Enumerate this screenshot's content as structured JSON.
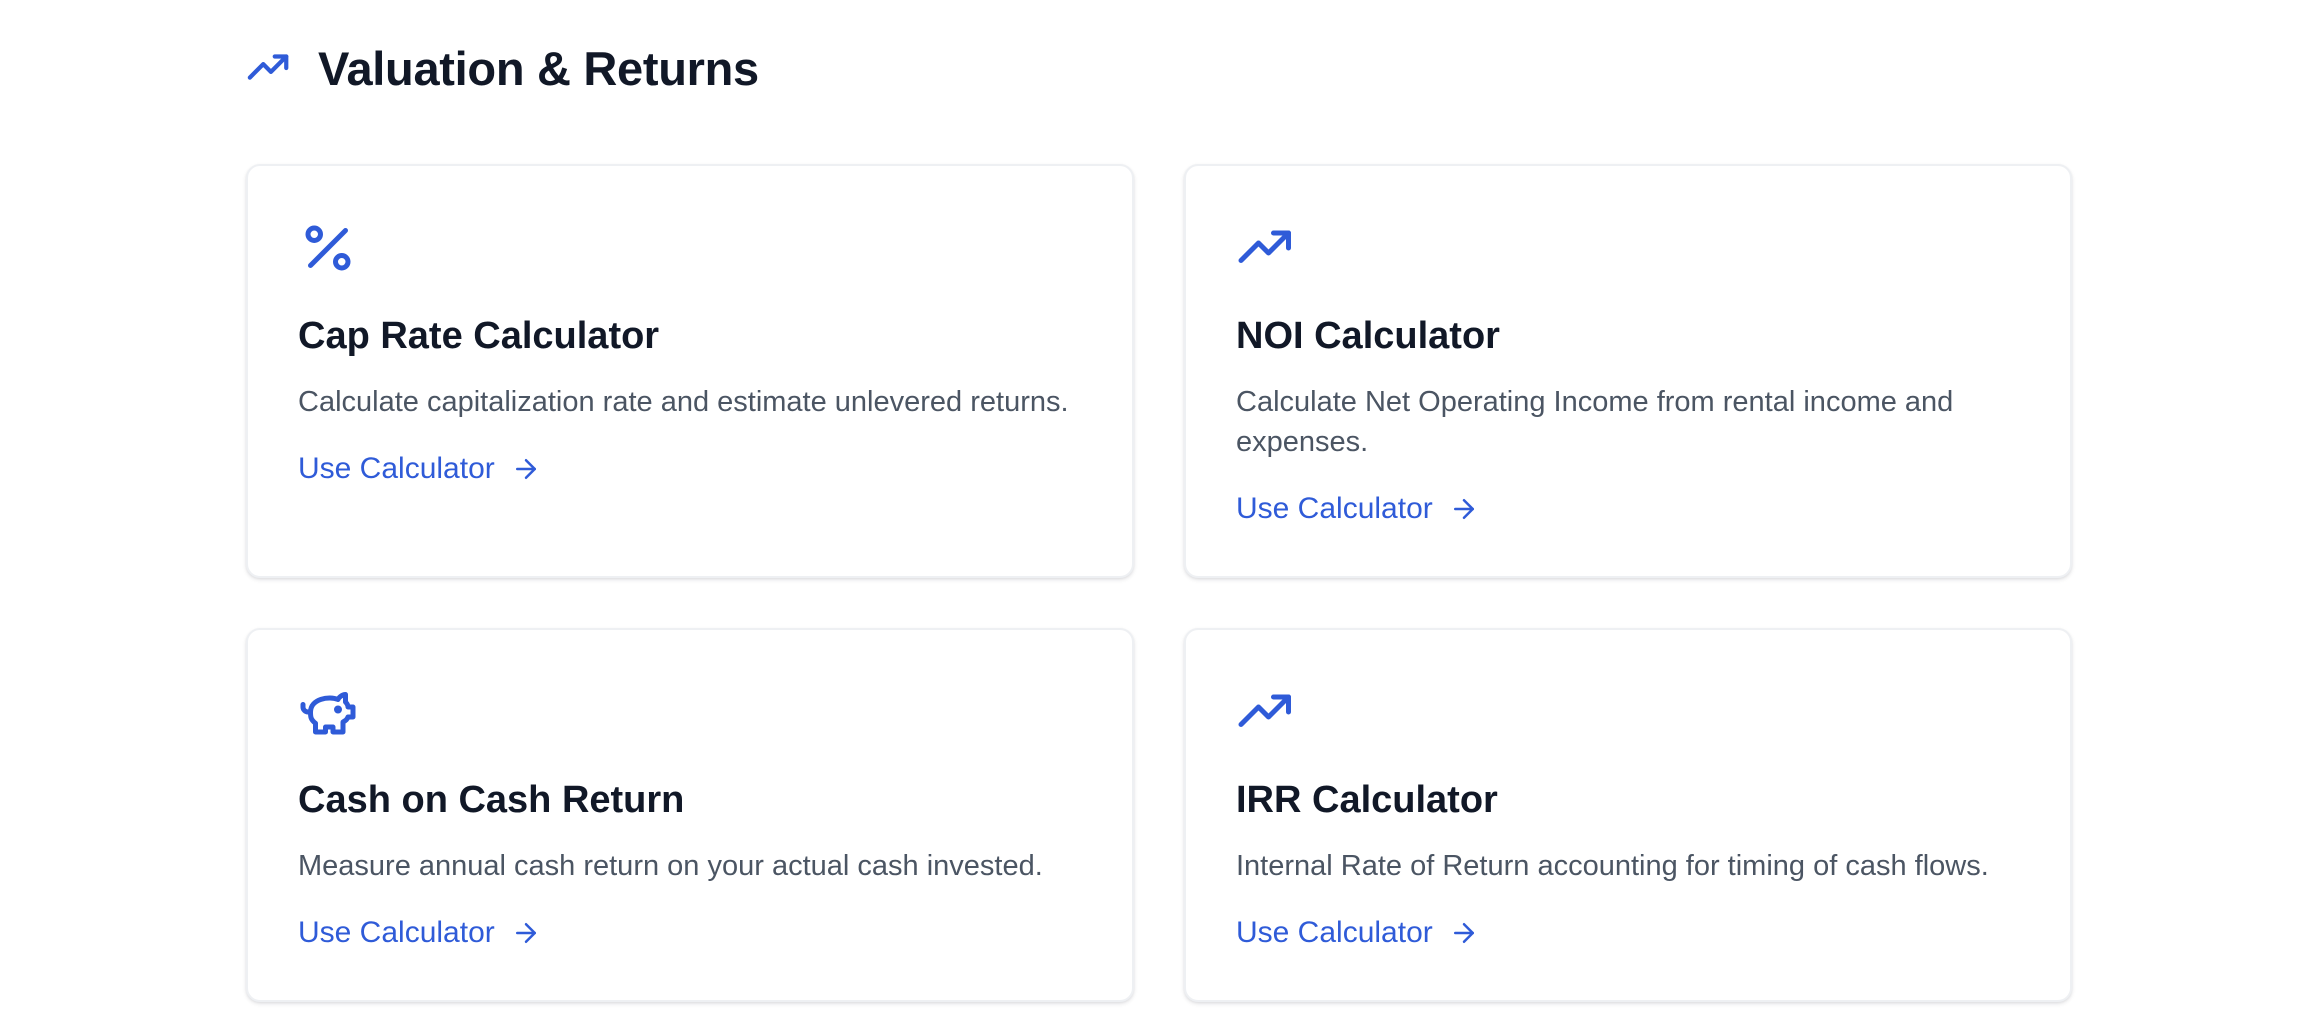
{
  "section": {
    "title": "Valuation & Returns",
    "icon": "trending-up-icon"
  },
  "colors": {
    "accent": "#2f5bd8",
    "title": "#111827",
    "body": "#4b5563"
  },
  "cards": [
    {
      "icon": "percent-icon",
      "title": "Cap Rate Calculator",
      "description": "Calculate capitalization rate and estimate unlevered returns.",
      "link_label": "Use Calculator"
    },
    {
      "icon": "trending-up-icon",
      "title": "NOI Calculator",
      "description": "Calculate Net Operating Income from rental income and expenses.",
      "link_label": "Use Calculator"
    },
    {
      "icon": "piggy-bank-icon",
      "title": "Cash on Cash Return",
      "description": "Measure annual cash return on your actual cash invested.",
      "link_label": "Use Calculator"
    },
    {
      "icon": "trending-up-icon",
      "title": "IRR Calculator",
      "description": "Internal Rate of Return accounting for timing of cash flows.",
      "link_label": "Use Calculator"
    }
  ]
}
